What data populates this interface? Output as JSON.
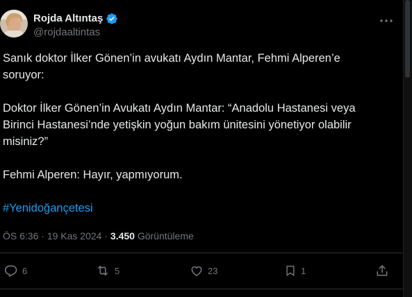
{
  "author": {
    "display_name": "Rojda Altıntaş",
    "handle": "@rojdaaltintas"
  },
  "tweet": {
    "paragraphs": [
      "Sanık doktor İlker Gönen’in avukatı Aydın Mantar, Fehmi Alperen’e soruyor:",
      "Doktor İlker Gönen’in Avukatı Aydın Mantar: “Anadolu Hastanesi veya Birinci Hastanesi’nde yetişkin yoğun bakım ünitesini yönetiyor olabilir misiniz?”",
      "Fehmi Alperen: Hayır, yapmıyorum."
    ],
    "hashtag": "#Yenidoğançetesi"
  },
  "meta": {
    "time": "ÖS 6:36",
    "separator": " · ",
    "date": "19 Kas 2024",
    "views_count": "3.450",
    "views_label": "Görüntüleme"
  },
  "actions": {
    "replies": "6",
    "reposts": "5",
    "likes": "23",
    "bookmarks": "1"
  },
  "colors": {
    "background": "#000000",
    "text": "#e7e9ea",
    "secondary": "#71767b",
    "accent": "#1d9bf0",
    "divider": "#2f3336"
  },
  "icons": [
    "verified-badge-icon",
    "more-options-icon",
    "reply-icon",
    "repost-icon",
    "like-icon",
    "bookmark-icon",
    "share-icon"
  ]
}
